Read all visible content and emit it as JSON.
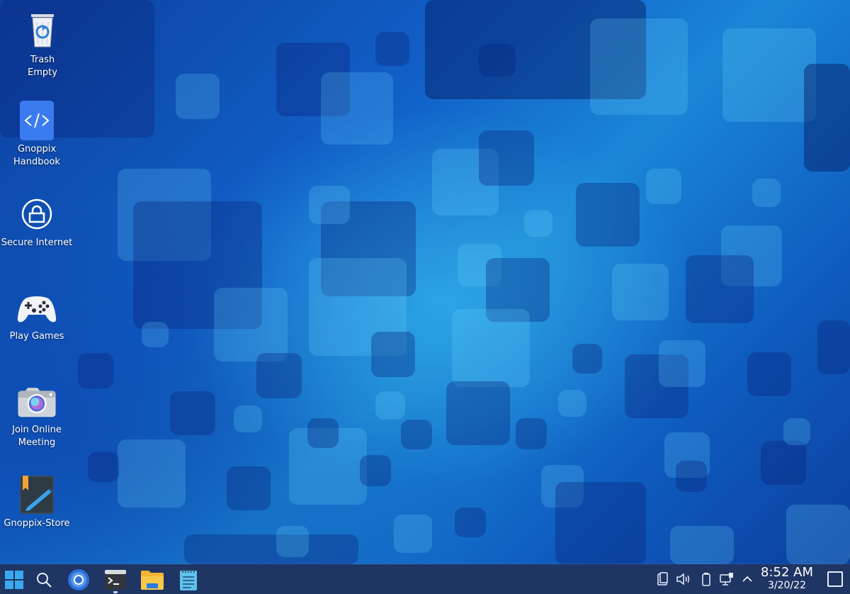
{
  "desktop": {
    "icons": [
      {
        "label": "Trash\nEmpty",
        "icon": "trash-icon"
      },
      {
        "label": "Gnoppix\nHandbook",
        "icon": "code-icon"
      },
      {
        "label": "Secure Internet",
        "icon": "lock-icon"
      },
      {
        "label": "Play Games",
        "icon": "gamepad-icon"
      },
      {
        "label": "Join Online\nMeeting",
        "icon": "camera-icon"
      },
      {
        "label": "Gnoppix-Store",
        "icon": "notebook-pen-icon"
      }
    ]
  },
  "taskbar": {
    "apps": [
      "windows-start-icon",
      "search-icon",
      "chromium-icon",
      "terminal-icon",
      "file-manager-icon",
      "notes-icon"
    ],
    "tray": [
      "clipboard-icon",
      "volume-icon",
      "battery-icon",
      "network-icon",
      "chevron-up-icon"
    ],
    "clock": {
      "time": "8:52 AM",
      "date": "3/20/22"
    }
  },
  "colors": {
    "taskbar": "#1f3564",
    "accent": "#3b7bf0"
  }
}
